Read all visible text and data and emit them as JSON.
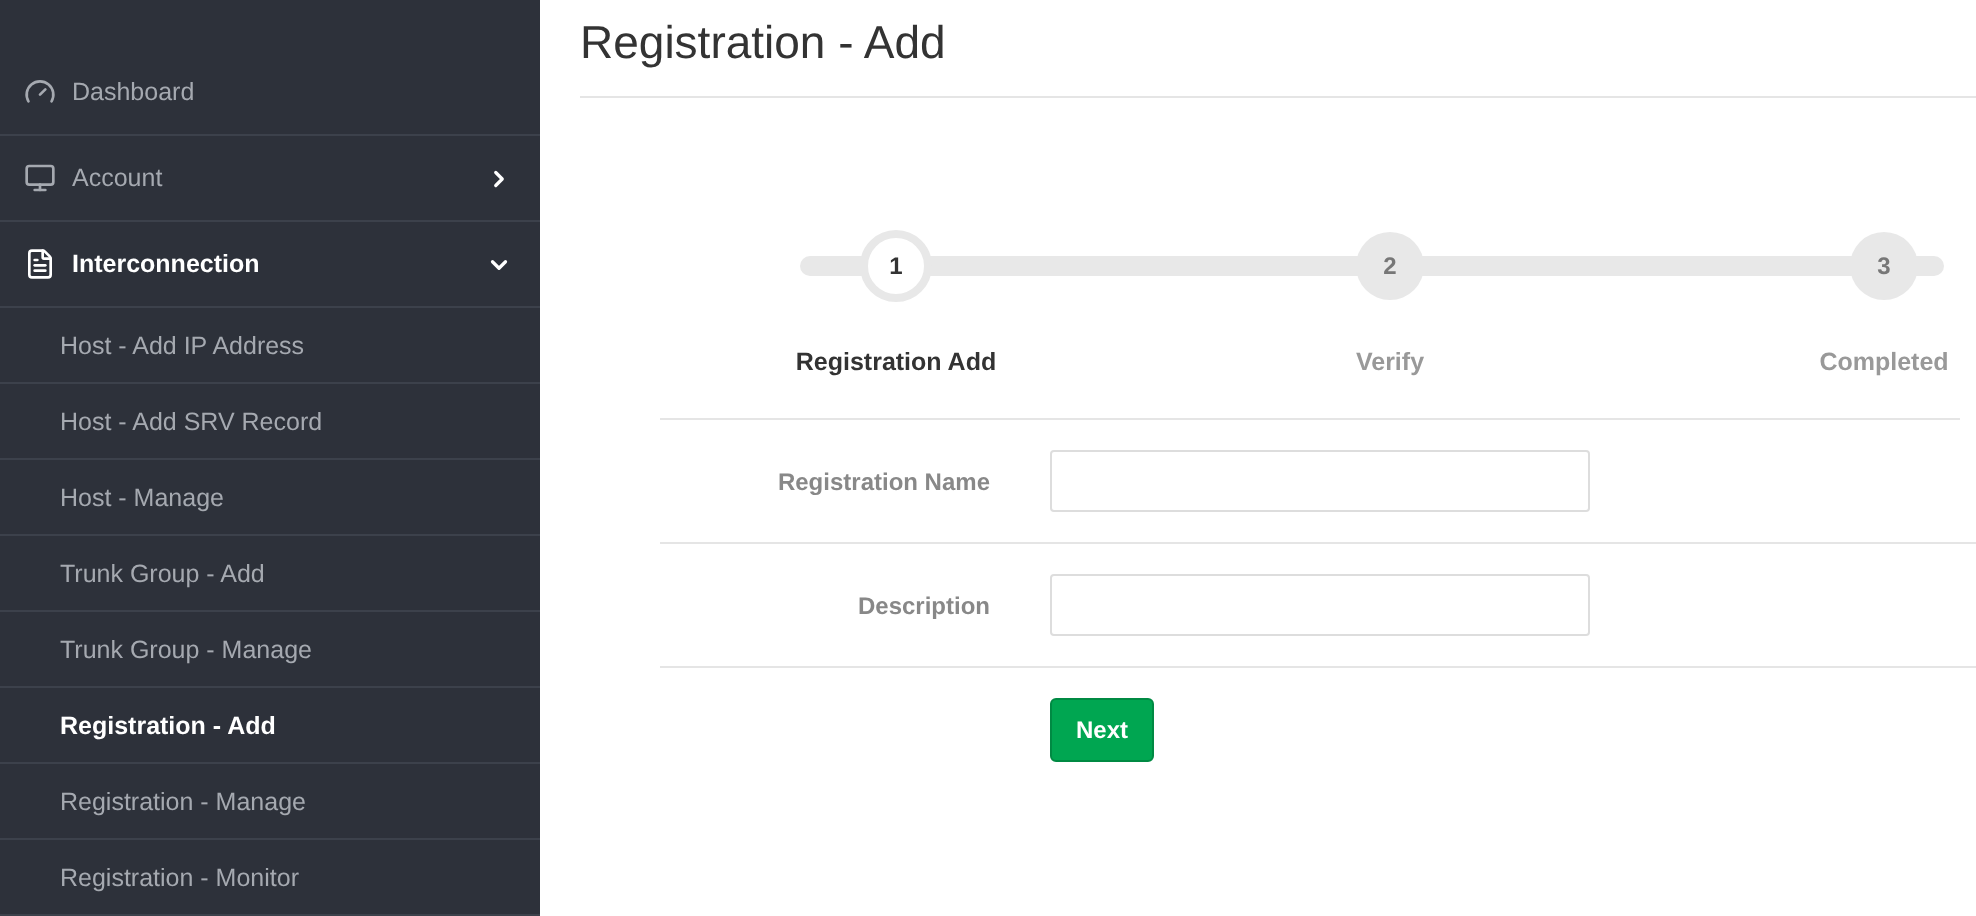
{
  "sidebar": {
    "items": [
      {
        "label": "Dashboard",
        "active": false
      },
      {
        "label": "Account",
        "active": false,
        "expanded": false
      },
      {
        "label": "Interconnection",
        "active": true,
        "expanded": true,
        "children": [
          {
            "label": "Host - Add IP Address",
            "selected": false
          },
          {
            "label": "Host - Add SRV Record",
            "selected": false
          },
          {
            "label": "Host - Manage",
            "selected": false
          },
          {
            "label": "Trunk Group - Add",
            "selected": false
          },
          {
            "label": "Trunk Group - Manage",
            "selected": false
          },
          {
            "label": "Registration - Add",
            "selected": true
          },
          {
            "label": "Registration - Manage",
            "selected": false
          },
          {
            "label": "Registration - Monitor",
            "selected": false
          }
        ]
      }
    ]
  },
  "page": {
    "title": "Registration - Add"
  },
  "steps": [
    {
      "number": "1",
      "label": "Registration Add",
      "selected": true
    },
    {
      "number": "2",
      "label": "Verify",
      "selected": false
    },
    {
      "number": "3",
      "label": "Completed",
      "selected": false
    }
  ],
  "form": {
    "fields": [
      {
        "label": "Registration Name"
      },
      {
        "label": "Description"
      }
    ],
    "submit": "Next"
  }
}
